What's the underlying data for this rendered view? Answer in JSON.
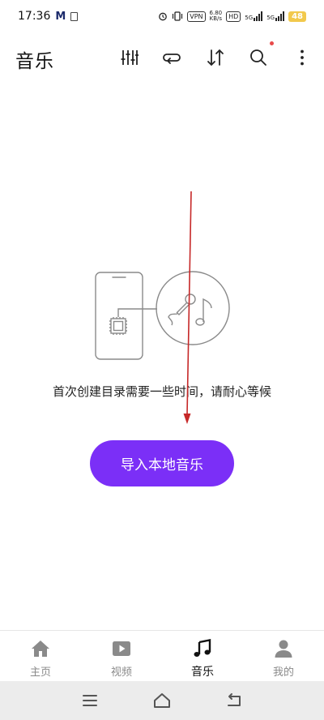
{
  "status_bar": {
    "time": "17:36",
    "mail_letter": "M",
    "vpn": "VPN",
    "speed_value": "6.80",
    "speed_unit": "KB/s",
    "hd": "HD",
    "net1": "5G",
    "net2": "5G",
    "battery": "48"
  },
  "header": {
    "title": "音乐",
    "icons": [
      "equalizer-icon",
      "repeat-icon",
      "sort-icon",
      "search-icon",
      "more-icon"
    ]
  },
  "empty_state": {
    "message": "首次创建目录需要一些时间，请耐心等候",
    "import_button": "导入本地音乐"
  },
  "bottom_nav": {
    "items": [
      {
        "label": "主页",
        "icon": "home-icon",
        "active": false
      },
      {
        "label": "视频",
        "icon": "video-icon",
        "active": false
      },
      {
        "label": "音乐",
        "icon": "music-note-icon",
        "active": true
      },
      {
        "label": "我的",
        "icon": "profile-icon",
        "active": false
      }
    ]
  },
  "colors": {
    "accent": "#7b2ff7",
    "annotation": "#c62828",
    "notification_dot": "#e84a4a"
  }
}
